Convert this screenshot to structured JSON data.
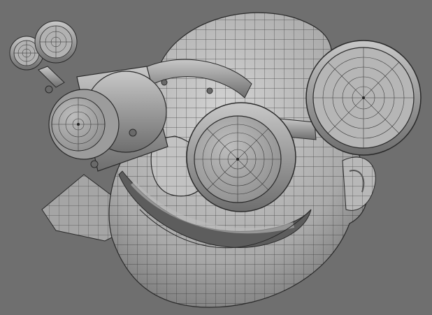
{
  "viewport": {
    "background": "#6f6f6f",
    "render_mode": "wireframe-on-shaded",
    "subject": "3d-character-head-with-goggles"
  },
  "colors": {
    "mesh_fill": "#b4b4b4",
    "mesh_light": "#cfcfcf",
    "mesh_dark": "#7c7c7c",
    "wire": "#2a2a2a"
  }
}
